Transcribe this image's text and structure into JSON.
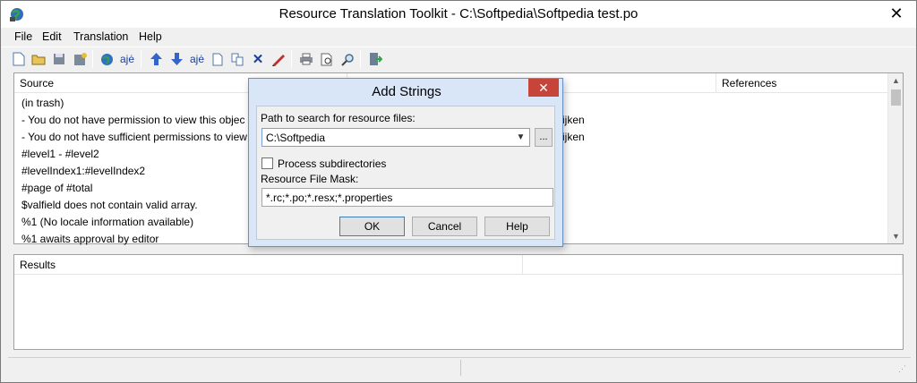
{
  "window": {
    "title": "Resource Translation Toolkit - C:\\Softpedia\\Softpedia test.po",
    "close_glyph": "✕"
  },
  "menu": [
    "File",
    "Edit",
    "Translation",
    "Help"
  ],
  "toolbar": {
    "icons": [
      "new-file-icon",
      "open-folder-icon",
      "save-icon",
      "save-all-icon",
      "globe-icon",
      "spellcheck-icon",
      "arrow-up-icon",
      "arrow-down-icon",
      "translate-icon",
      "page-icon",
      "copy-icon",
      "delete-icon",
      "edit-pen-icon",
      "print-icon",
      "print-preview-icon",
      "find-icon",
      "exit-icon"
    ],
    "glyphs": {
      "translate": "ajė",
      "delete": "✕"
    }
  },
  "strings_table": {
    "columns": [
      "Source",
      "",
      "References"
    ],
    "rows": [
      " (in trash)",
      " - You do not have permission to view this objec",
      " - You do not have sufficient permissions to view",
      "#level1 - #level2",
      "#levelIndex1:#levelIndex2",
      "#page of #total",
      "$valfield does not contain valid array.",
      "%1 (No locale information available)",
      "%1 awaits approval by editor"
    ],
    "translations_visible": [
      "ijken",
      "ijken"
    ]
  },
  "results": {
    "columns": [
      "Results",
      ""
    ]
  },
  "dialog": {
    "title": "Add Strings",
    "path_label": "Path to search for resource files:",
    "path_value": "C:\\Softpedia",
    "browse_label": "...",
    "subdirs_label": "Process subdirectories",
    "subdirs_checked": false,
    "mask_label": "Resource File Mask:",
    "mask_value": "*.rc;*.po;*.resx;*.properties",
    "buttons": {
      "ok": "OK",
      "cancel": "Cancel",
      "help": "Help"
    }
  },
  "colors": {
    "dialog_frame": "#d8e6f7",
    "close_button": "#c7443a",
    "accent": "#3c7fb1"
  }
}
